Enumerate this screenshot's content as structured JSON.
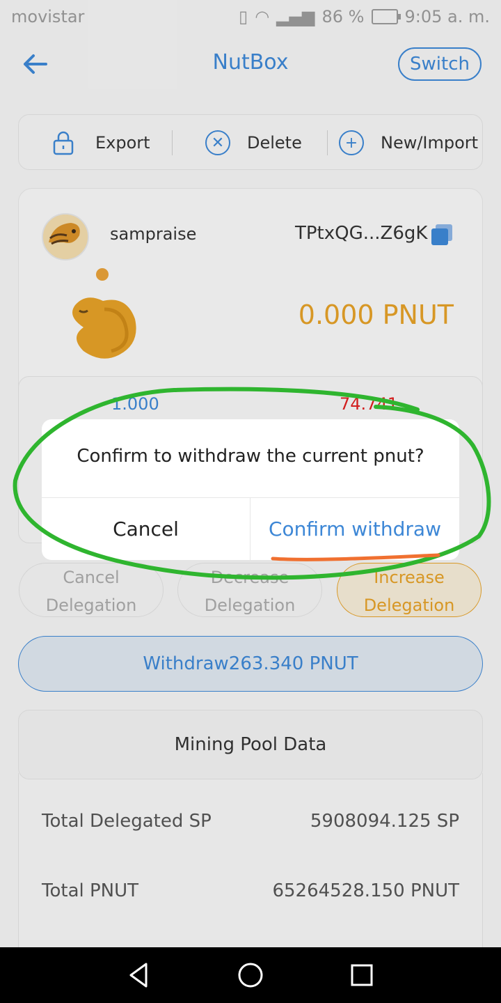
{
  "status_bar": {
    "carrier": "movistar",
    "battery": "86 %",
    "time": "9:05 a. m."
  },
  "header": {
    "title": "NutBox",
    "switch_label": "Switch"
  },
  "toolbar": {
    "export": "Export",
    "delete": "Delete",
    "new_import": "New/Import"
  },
  "account": {
    "username": "sampraise",
    "address": "TPtxQG...Z6gK",
    "balance": "0.000 PNUT"
  },
  "stats": {
    "left_value": "1.000",
    "right_value": "74.741"
  },
  "delegation": {
    "cancel": [
      "Cancel",
      "Delegation"
    ],
    "decrease": [
      "Decrease",
      "Delegation"
    ],
    "increase": [
      "Increase",
      "Delegation"
    ]
  },
  "withdraw_button": "Withdraw263.340 PNUT",
  "pool": {
    "title": "Mining Pool Data",
    "rows": [
      {
        "label": "Total Delegated SP",
        "value": "5908094.125 SP"
      },
      {
        "label": "Total PNUT",
        "value": "65264528.150 PNUT"
      }
    ]
  },
  "dialog": {
    "message": "Confirm to withdraw the current pnut?",
    "cancel": "Cancel",
    "confirm": "Confirm withdraw"
  },
  "colors": {
    "accent": "#3d87d6",
    "gold": "#e5a128",
    "annotation_green": "#2fb52f",
    "annotation_orange": "#f07030"
  }
}
